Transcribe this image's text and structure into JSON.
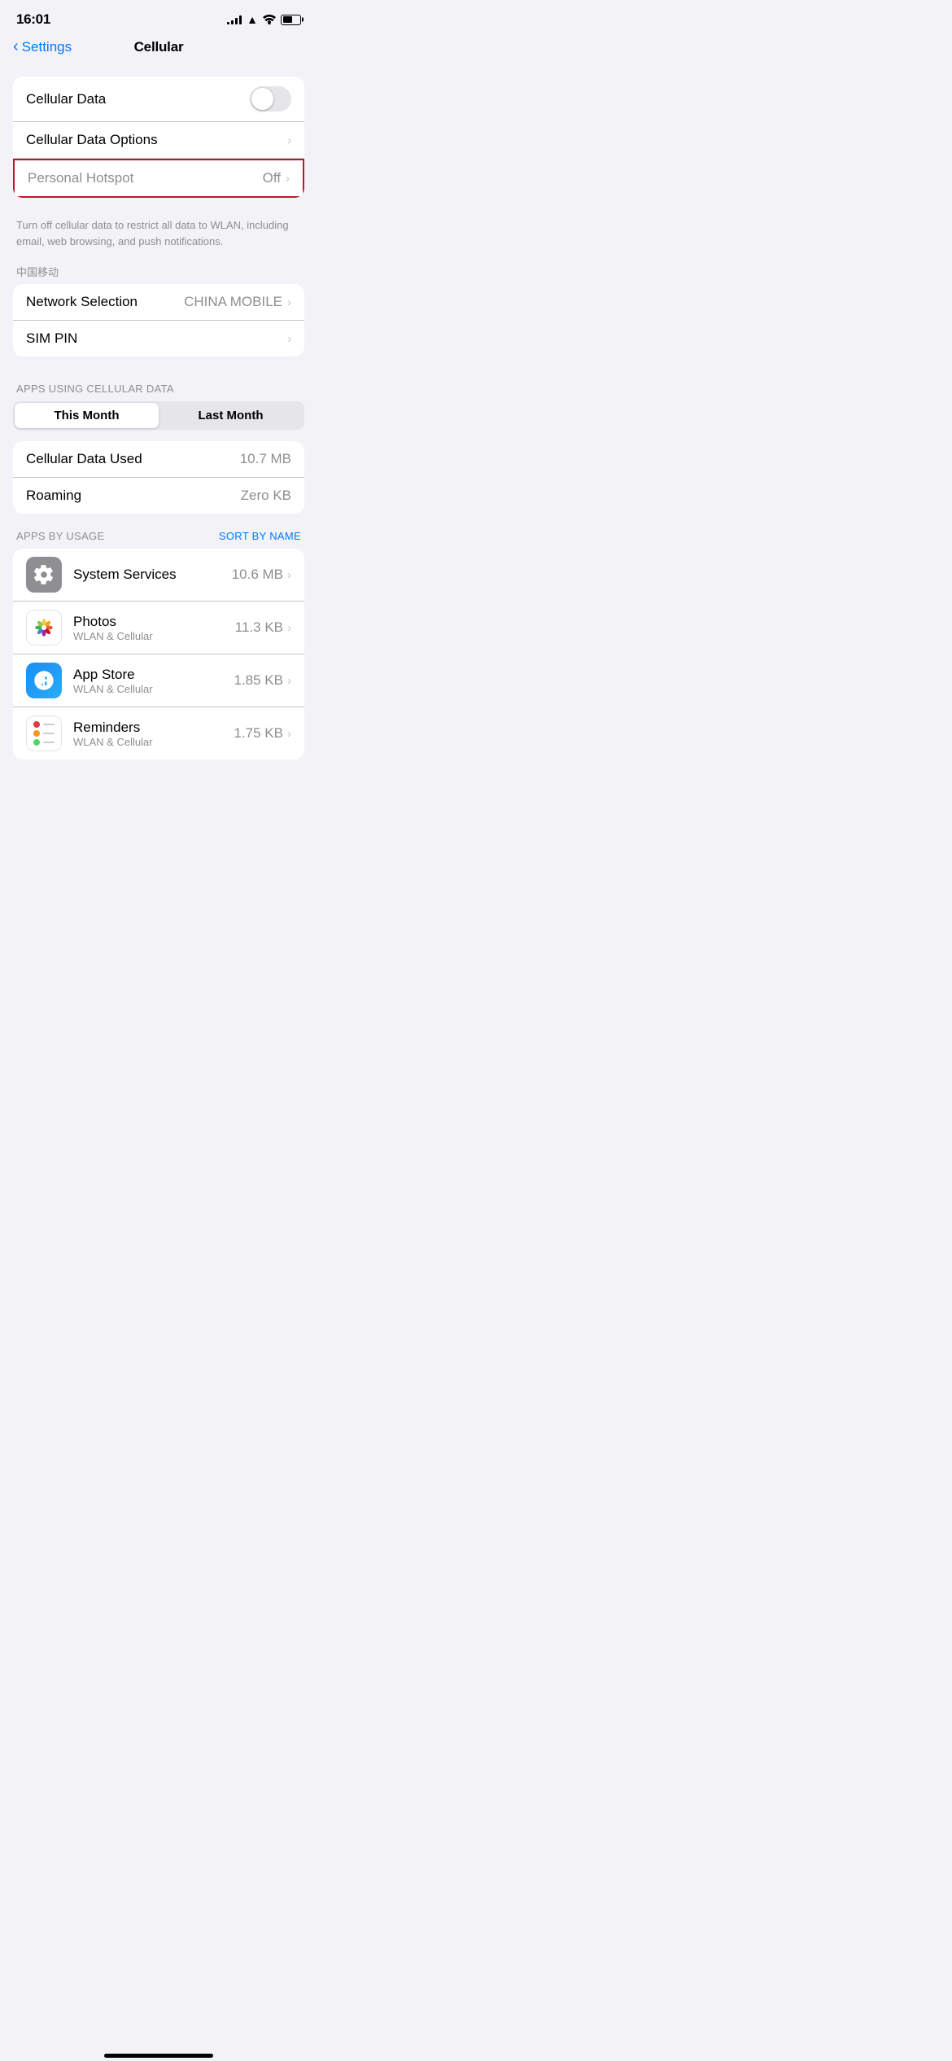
{
  "status_bar": {
    "time": "16:01",
    "signal_bars": 4,
    "battery_level": 55
  },
  "nav": {
    "back_label": "Settings",
    "title": "Cellular"
  },
  "cellular_section": {
    "cellular_data_label": "Cellular Data",
    "cellular_data_options_label": "Cellular Data Options",
    "personal_hotspot_label": "Personal Hotspot",
    "personal_hotspot_value": "Off",
    "description": "Turn off cellular data to restrict all data to WLAN, including email, web browsing, and push notifications.",
    "carrier_label": "中国移动",
    "network_selection_label": "Network Selection",
    "network_selection_value": "CHINA MOBILE",
    "sim_pin_label": "SIM PIN"
  },
  "apps_section": {
    "section_label": "APPS USING CELLULAR DATA",
    "segment": {
      "this_month": "This Month",
      "last_month": "Last Month"
    },
    "cellular_data_used_label": "Cellular Data Used",
    "cellular_data_used_value": "10.7 MB",
    "roaming_label": "Roaming",
    "roaming_value": "Zero KB",
    "apps_by_usage_label": "APPS BY USAGE",
    "sort_by_name_label": "SORT BY NAME",
    "apps": [
      {
        "name": "System Services",
        "sub": "",
        "size": "10.6 MB",
        "icon_type": "system"
      },
      {
        "name": "Photos",
        "sub": "WLAN & Cellular",
        "size": "11.3 KB",
        "icon_type": "photos"
      },
      {
        "name": "App Store",
        "sub": "WLAN & Cellular",
        "size": "1.85 KB",
        "icon_type": "appstore"
      },
      {
        "name": "Reminders",
        "sub": "WLAN & Cellular",
        "size": "1.75 KB",
        "icon_type": "reminders"
      }
    ]
  }
}
